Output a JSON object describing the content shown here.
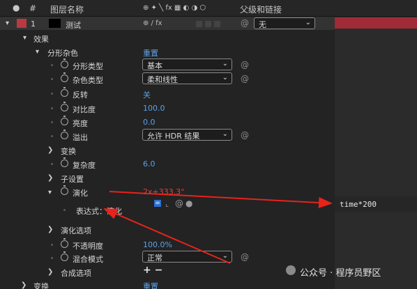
{
  "header": {
    "num_col": "#",
    "layer_name_col": "图层名称",
    "switch_icons": "⊕ ✦ ╲ fx ▦ ◐ ◑ ⬡",
    "parent_col": "父级和链接"
  },
  "layer": {
    "index": "1",
    "name": "测试",
    "switch_icons": "⊕ / fx",
    "parent_value": "无"
  },
  "tree": {
    "effects": "效果",
    "fractal_noise": "分形杂色",
    "reset": "重置",
    "fractal_type": {
      "label": "分形类型",
      "value": "基本"
    },
    "noise_type": {
      "label": "杂色类型",
      "value": "柔和线性"
    },
    "invert": {
      "label": "反转",
      "value": "关"
    },
    "contrast": {
      "label": "对比度",
      "value": "100.0"
    },
    "brightness": {
      "label": "亮度",
      "value": "0.0"
    },
    "overflow": {
      "label": "溢出",
      "value": "允许 HDR 结果"
    },
    "transform": "变换",
    "complexity": {
      "label": "复杂度",
      "value": "6.0"
    },
    "sub_settings": "子设置",
    "evolution": {
      "label": "演化",
      "value_prefix": "2",
      "value_rest": "x+333.3°"
    },
    "expression": {
      "label": "表达式：演化",
      "code": "time*200"
    },
    "evolution_options": "演化选项",
    "opacity": {
      "label": "不透明度",
      "value": "100.0%"
    },
    "blend_mode": {
      "label": "混合模式",
      "value": "正常"
    },
    "composite_options": {
      "label": "合成选项",
      "value": "+ −"
    },
    "transform2": "变换",
    "reset2": "重置"
  },
  "watermark": "公众号 · 程序员野区",
  "colors": {
    "label_color": "#b93a3f",
    "value_blue": "#5ca2e6",
    "expression_red": "#e0433b",
    "timeline_green": "#2eab4b",
    "timeline_bar": "#a02a36",
    "arrow_red": "#e8231c"
  }
}
